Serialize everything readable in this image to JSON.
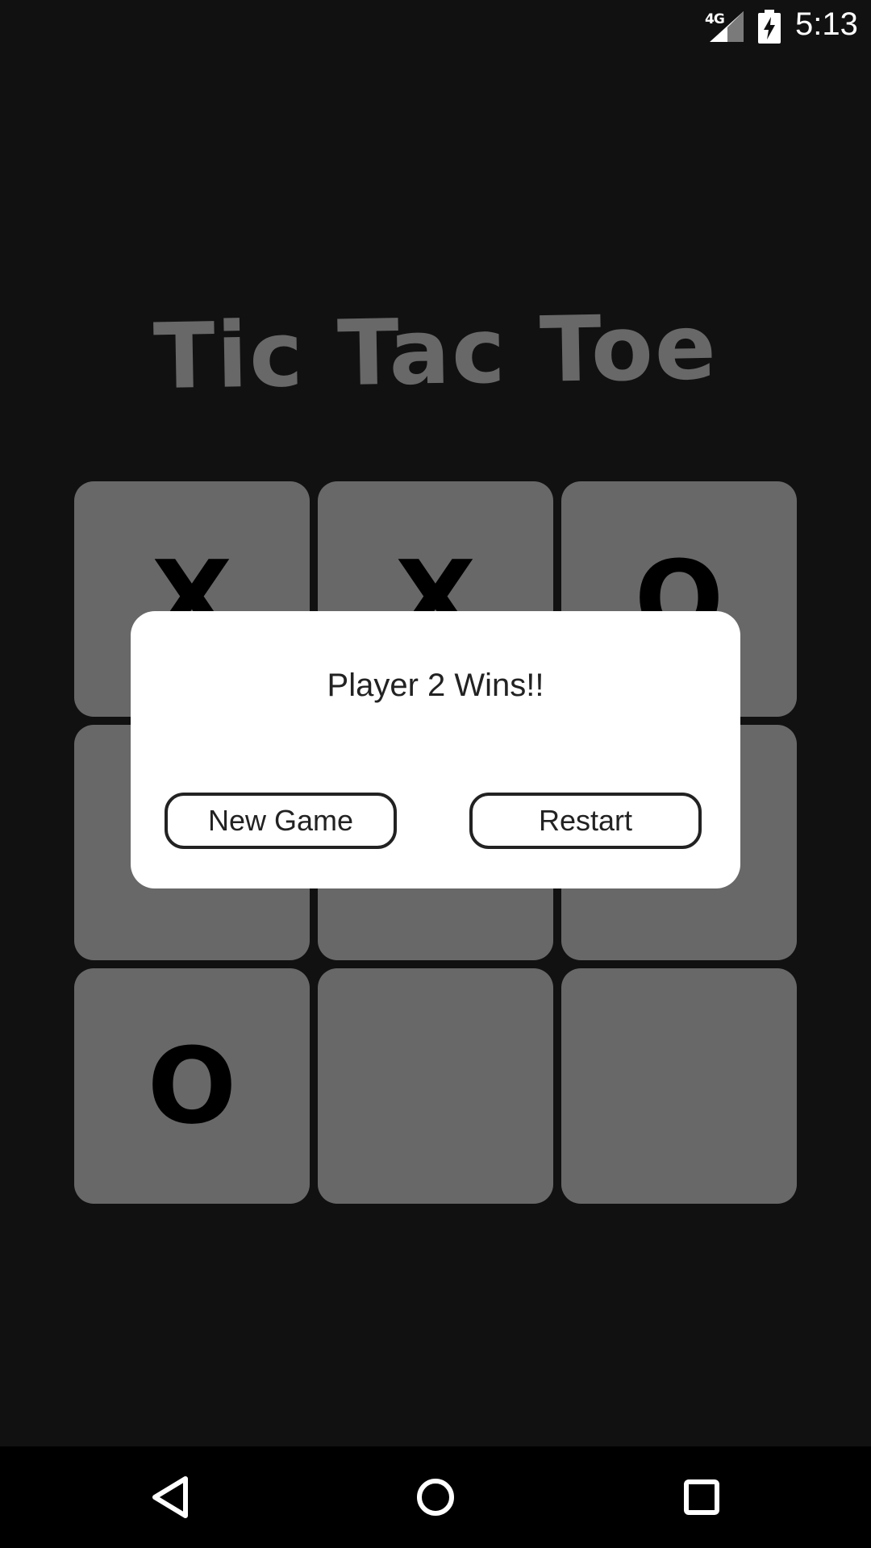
{
  "status_bar": {
    "network": "4G",
    "time": "5:13",
    "icons": [
      "signal-icon",
      "battery-charging-icon"
    ]
  },
  "title": "Tic Tac Toe",
  "board": {
    "cells": [
      "X",
      "X",
      "O",
      "",
      "",
      "",
      "O",
      "",
      ""
    ]
  },
  "dialog": {
    "message": "Player 2 Wins!!",
    "new_game_label": "New Game",
    "restart_label": "Restart"
  },
  "nav_bar": {
    "icons": [
      "back-icon",
      "home-icon",
      "recents-icon"
    ]
  },
  "colors": {
    "background": "#111111",
    "cell": "#686868",
    "title": "#686868",
    "dialog": "#ffffff"
  }
}
